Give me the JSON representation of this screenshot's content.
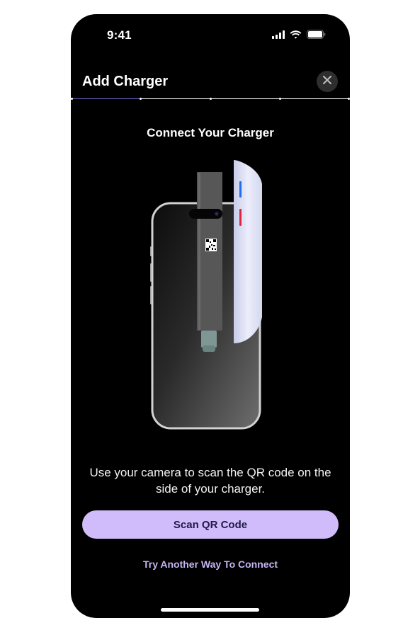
{
  "status_bar": {
    "time": "9:41",
    "icons": [
      "cellular-signal-icon",
      "wifi-icon",
      "battery-icon"
    ]
  },
  "header": {
    "title": "Add Charger",
    "close_icon": "close-icon"
  },
  "progress": {
    "steps": 5,
    "current_step": 2,
    "fill_color": "#6f64c9",
    "track_color": "#ffffff"
  },
  "main": {
    "step_title": "Connect Your Charger",
    "illustration": "phone-and-charger-illustration",
    "description": "Use your camera to scan the QR code on the side of your charger."
  },
  "actions": {
    "scan_label": "Scan QR Code",
    "alt_label": "Try Another Way To Connect"
  },
  "colors": {
    "background": "#000000",
    "primary_button": "#d0bcfa",
    "primary_button_text": "#22194a",
    "link_text": "#c7b4f4",
    "close_button_bg": "#2e2e2e"
  }
}
